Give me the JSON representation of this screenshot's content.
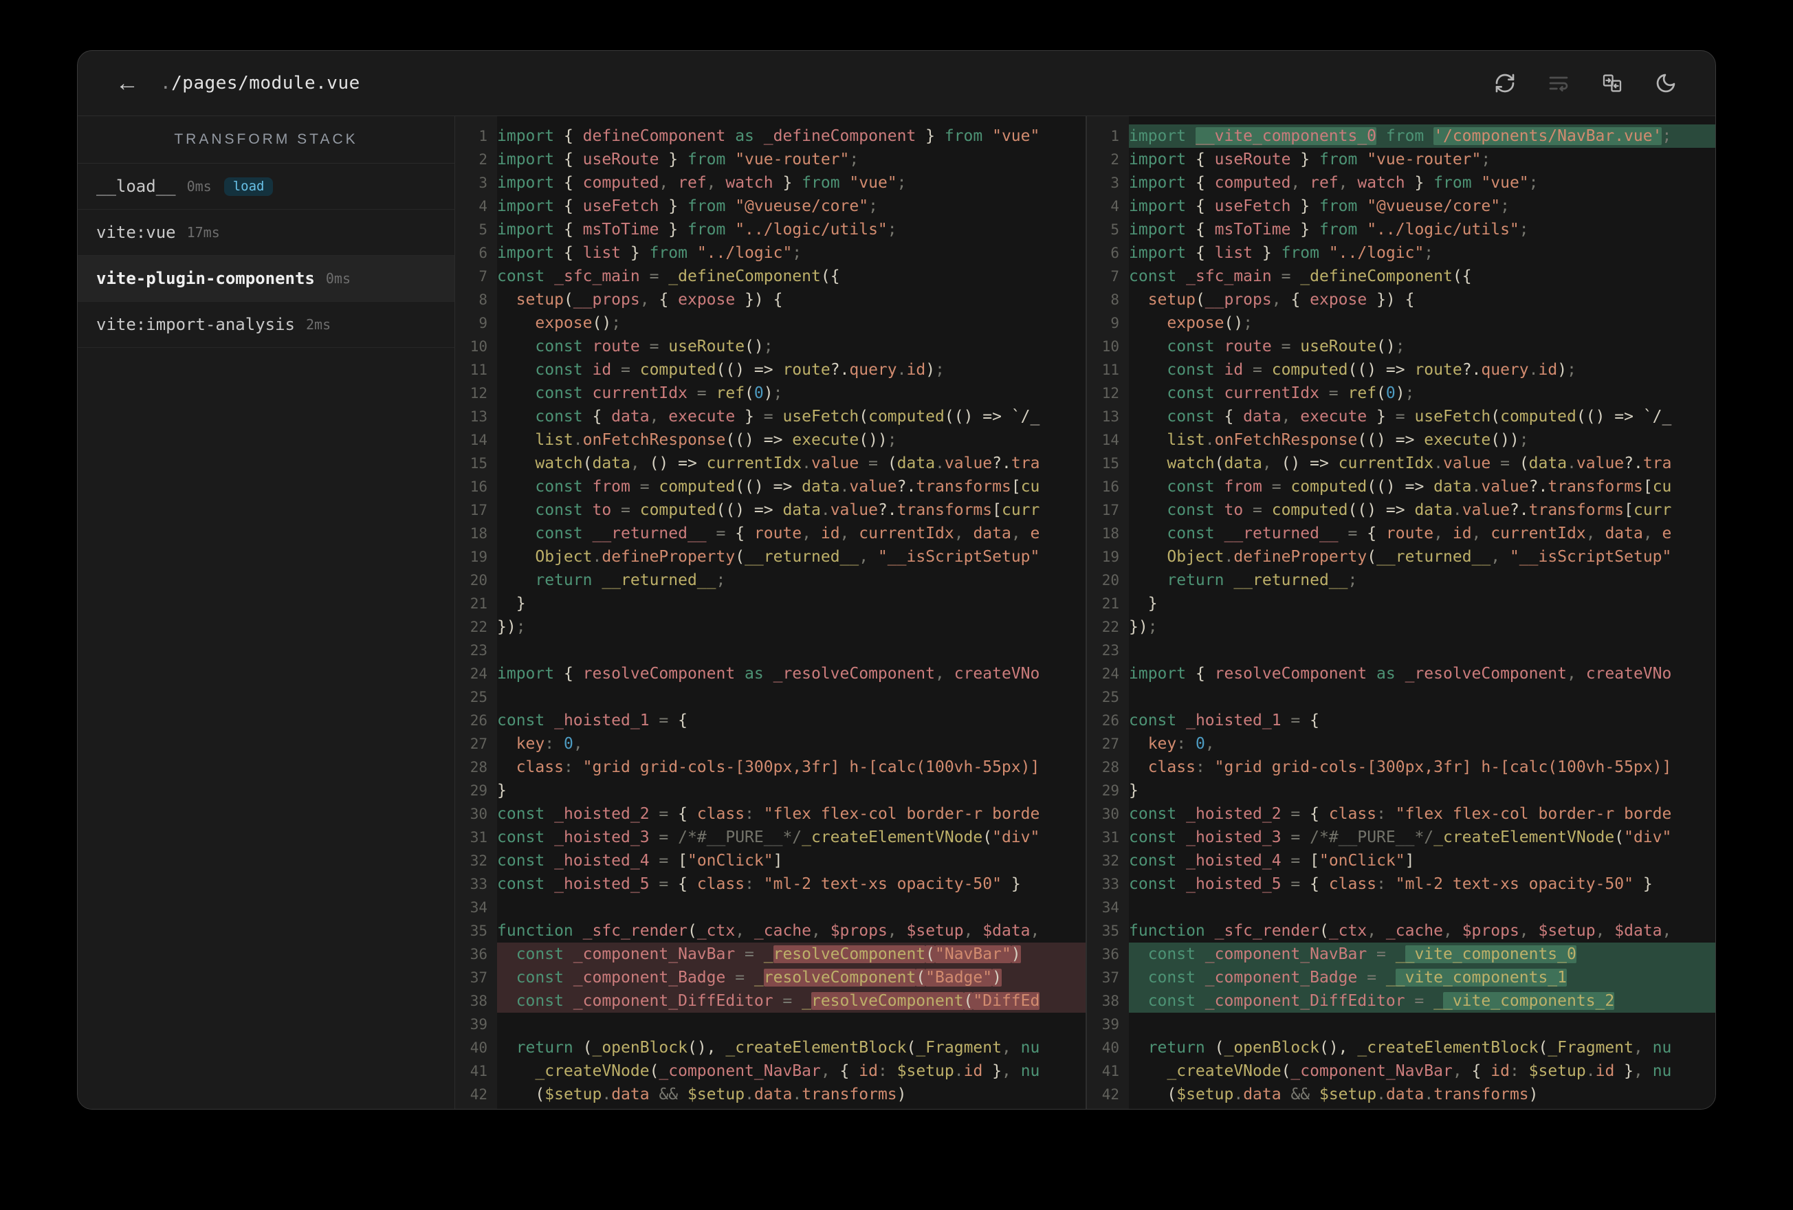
{
  "window": {
    "title_prefix": ".",
    "title": "/pages/module.vue",
    "back_label": "←"
  },
  "toolbar": {
    "icons": [
      "refresh-icon",
      "line-wrap-icon",
      "diff-compare-icon",
      "moon-icon"
    ]
  },
  "sidebar": {
    "header": "TRANSFORM STACK",
    "items": [
      {
        "name": "__load__",
        "time": "0ms",
        "badge": "load",
        "selected": false
      },
      {
        "name": "vite:vue",
        "time": "17ms",
        "badge": null,
        "selected": false
      },
      {
        "name": "vite-plugin-components",
        "time": "0ms",
        "badge": null,
        "selected": true
      },
      {
        "name": "vite:import-analysis",
        "time": "2ms",
        "badge": null,
        "selected": false
      }
    ]
  },
  "colors": {
    "keyword": "#4D9375",
    "declaration": "#CB7C7C",
    "reference": "#BDB069",
    "string": "#D28B6F",
    "punctuation": "#D6D1C2",
    "number": "#4D9BC1",
    "diff_del_line": "#3A2829",
    "diff_del_word": "#824A4A",
    "diff_add_line": "#2A4A3C",
    "diff_add_word": "#3F7158",
    "badge_text": "#68C0E6",
    "badge_bg": "#14323E"
  },
  "code": {
    "left_diff_del": [
      36,
      37,
      38
    ],
    "right_diff_add": [
      1,
      36,
      37,
      38
    ],
    "common_lines": [
      [
        [
          "k",
          "import"
        ],
        [
          "p",
          " { "
        ],
        [
          "d",
          "defineComponent"
        ],
        [
          "k",
          " as "
        ],
        [
          "d",
          "_defineComponent"
        ],
        [
          "p",
          " } "
        ],
        [
          "k",
          "from"
        ],
        [
          "s",
          " \"vue\""
        ]
      ],
      [
        [
          "k",
          "import"
        ],
        [
          "p",
          " { "
        ],
        [
          "d",
          "useRoute"
        ],
        [
          "p",
          " } "
        ],
        [
          "k",
          "from"
        ],
        [
          "s",
          " \"vue-router\""
        ],
        [
          "o",
          ";"
        ]
      ],
      [
        [
          "k",
          "import"
        ],
        [
          "p",
          " { "
        ],
        [
          "d",
          "computed"
        ],
        [
          "o",
          ", "
        ],
        [
          "d",
          "ref"
        ],
        [
          "o",
          ", "
        ],
        [
          "d",
          "watch"
        ],
        [
          "p",
          " } "
        ],
        [
          "k",
          "from"
        ],
        [
          "s",
          " \"vue\""
        ],
        [
          "o",
          ";"
        ]
      ],
      [
        [
          "k",
          "import"
        ],
        [
          "p",
          " { "
        ],
        [
          "d",
          "useFetch"
        ],
        [
          "p",
          " } "
        ],
        [
          "k",
          "from"
        ],
        [
          "s",
          " \"@vueuse/core\""
        ],
        [
          "o",
          ";"
        ]
      ],
      [
        [
          "k",
          "import"
        ],
        [
          "p",
          " { "
        ],
        [
          "d",
          "msToTime"
        ],
        [
          "p",
          " } "
        ],
        [
          "k",
          "from"
        ],
        [
          "s",
          " \"../logic/utils\""
        ],
        [
          "o",
          ";"
        ]
      ],
      [
        [
          "k",
          "import"
        ],
        [
          "p",
          " { "
        ],
        [
          "d",
          "list"
        ],
        [
          "p",
          " } "
        ],
        [
          "k",
          "from"
        ],
        [
          "s",
          " \"../logic\""
        ],
        [
          "o",
          ";"
        ]
      ],
      [
        [
          "k",
          "const"
        ],
        [
          "d",
          " _sfc_main"
        ],
        [
          "o",
          " = "
        ],
        [
          "u",
          "_defineComponent"
        ],
        [
          "p",
          "({"
        ]
      ],
      [
        [
          "s",
          "  setup"
        ],
        [
          "p",
          "("
        ],
        [
          "d",
          "__props"
        ],
        [
          "o",
          ", "
        ],
        [
          "p",
          "{ "
        ],
        [
          "d",
          "expose"
        ],
        [
          "p",
          " })"
        ],
        [
          "p",
          " {"
        ]
      ],
      [
        [
          "s",
          "    expose"
        ],
        [
          "p",
          "()"
        ],
        [
          "o",
          ";"
        ]
      ],
      [
        [
          "k",
          "    const"
        ],
        [
          "d",
          " route"
        ],
        [
          "o",
          " = "
        ],
        [
          "u",
          "useRoute"
        ],
        [
          "p",
          "()"
        ],
        [
          "o",
          ";"
        ]
      ],
      [
        [
          "k",
          "    const"
        ],
        [
          "d",
          " id"
        ],
        [
          "o",
          " = "
        ],
        [
          "u",
          "computed"
        ],
        [
          "p",
          "(() => "
        ],
        [
          "u",
          "route"
        ],
        [
          "p",
          "?."
        ],
        [
          "s",
          "query"
        ],
        [
          "o",
          "."
        ],
        [
          "s",
          "id"
        ],
        [
          "p",
          ")"
        ],
        [
          "o",
          ";"
        ]
      ],
      [
        [
          "k",
          "    const"
        ],
        [
          "d",
          " currentIdx"
        ],
        [
          "o",
          " = "
        ],
        [
          "u",
          "ref"
        ],
        [
          "p",
          "("
        ],
        [
          "n",
          "0"
        ],
        [
          "p",
          ")"
        ],
        [
          "o",
          ";"
        ]
      ],
      [
        [
          "k",
          "    const"
        ],
        [
          "p",
          " { "
        ],
        [
          "d",
          "data"
        ],
        [
          "o",
          ", "
        ],
        [
          "d",
          "execute"
        ],
        [
          "p",
          " } "
        ],
        [
          "o",
          "= "
        ],
        [
          "u",
          "useFetch"
        ],
        [
          "p",
          "("
        ],
        [
          "u",
          "computed"
        ],
        [
          "p",
          "(() => "
        ],
        [
          "w",
          "`/_"
        ]
      ],
      [
        [
          "u",
          "    list"
        ],
        [
          "o",
          "."
        ],
        [
          "s",
          "onFetchResponse"
        ],
        [
          "p",
          "(() => "
        ],
        [
          "u",
          "execute"
        ],
        [
          "p",
          "())"
        ],
        [
          "o",
          ";"
        ]
      ],
      [
        [
          "u",
          "    watch"
        ],
        [
          "p",
          "("
        ],
        [
          "u",
          "data"
        ],
        [
          "o",
          ", "
        ],
        [
          "p",
          "() => "
        ],
        [
          "u",
          "currentIdx"
        ],
        [
          "o",
          "."
        ],
        [
          "s",
          "value"
        ],
        [
          "o",
          " = "
        ],
        [
          "p",
          "("
        ],
        [
          "u",
          "data"
        ],
        [
          "o",
          "."
        ],
        [
          "s",
          "value"
        ],
        [
          "p",
          "?."
        ],
        [
          "s",
          "tra"
        ]
      ],
      [
        [
          "k",
          "    const"
        ],
        [
          "d",
          " from"
        ],
        [
          "o",
          " = "
        ],
        [
          "u",
          "computed"
        ],
        [
          "p",
          "(() => "
        ],
        [
          "u",
          "data"
        ],
        [
          "o",
          "."
        ],
        [
          "s",
          "value"
        ],
        [
          "p",
          "?."
        ],
        [
          "s",
          "transforms"
        ],
        [
          "p",
          "["
        ],
        [
          "u",
          "cu"
        ]
      ],
      [
        [
          "k",
          "    const"
        ],
        [
          "d",
          " to"
        ],
        [
          "o",
          " = "
        ],
        [
          "u",
          "computed"
        ],
        [
          "p",
          "(() => "
        ],
        [
          "u",
          "data"
        ],
        [
          "o",
          "."
        ],
        [
          "s",
          "value"
        ],
        [
          "p",
          "?."
        ],
        [
          "s",
          "transforms"
        ],
        [
          "p",
          "["
        ],
        [
          "u",
          "curr"
        ]
      ],
      [
        [
          "k",
          "    const"
        ],
        [
          "d",
          " __returned__"
        ],
        [
          "o",
          " = "
        ],
        [
          "p",
          "{ "
        ],
        [
          "s",
          "route"
        ],
        [
          "o",
          ", "
        ],
        [
          "s",
          "id"
        ],
        [
          "o",
          ", "
        ],
        [
          "s",
          "currentIdx"
        ],
        [
          "o",
          ", "
        ],
        [
          "s",
          "data"
        ],
        [
          "o",
          ", "
        ],
        [
          "s",
          "e"
        ]
      ],
      [
        [
          "u",
          "    Object"
        ],
        [
          "o",
          "."
        ],
        [
          "s",
          "defineProperty"
        ],
        [
          "p",
          "("
        ],
        [
          "u",
          "__returned__"
        ],
        [
          "o",
          ", "
        ],
        [
          "s",
          "\"__isScriptSetup\""
        ]
      ],
      [
        [
          "k",
          "    return"
        ],
        [
          "u",
          " __returned__"
        ],
        [
          "o",
          ";"
        ]
      ],
      [
        [
          "p",
          "  }"
        ]
      ],
      [
        [
          "p",
          "})"
        ],
        [
          "o",
          ";"
        ]
      ],
      [],
      [
        [
          "k",
          "import"
        ],
        [
          "p",
          " { "
        ],
        [
          "d",
          "resolveComponent"
        ],
        [
          "k",
          " as "
        ],
        [
          "d",
          "_resolveComponent"
        ],
        [
          "o",
          ", "
        ],
        [
          "d",
          "createVNo"
        ]
      ],
      [],
      [
        [
          "k",
          "const"
        ],
        [
          "d",
          " _hoisted_1"
        ],
        [
          "o",
          " = "
        ],
        [
          "p",
          "{"
        ]
      ],
      [
        [
          "s",
          "  key"
        ],
        [
          "o",
          ": "
        ],
        [
          "n",
          "0"
        ],
        [
          "o",
          ","
        ]
      ],
      [
        [
          "s",
          "  class"
        ],
        [
          "o",
          ": "
        ],
        [
          "s",
          "\"grid grid-cols-[300px,3fr] h-[calc(100vh-55px)]"
        ]
      ],
      [
        [
          "p",
          "}"
        ]
      ],
      [
        [
          "k",
          "const"
        ],
        [
          "d",
          " _hoisted_2"
        ],
        [
          "o",
          " = "
        ],
        [
          "p",
          "{ "
        ],
        [
          "s",
          "class"
        ],
        [
          "o",
          ": "
        ],
        [
          "s",
          "\"flex flex-col border-r borde"
        ]
      ],
      [
        [
          "k",
          "const"
        ],
        [
          "d",
          " _hoisted_3"
        ],
        [
          "o",
          " = "
        ],
        [
          "c",
          "/*#__PURE__*/"
        ],
        [
          "u",
          "_createElementVNode"
        ],
        [
          "p",
          "("
        ],
        [
          "s",
          "\"div\""
        ]
      ],
      [
        [
          "k",
          "const"
        ],
        [
          "d",
          " _hoisted_4"
        ],
        [
          "o",
          " = "
        ],
        [
          "p",
          "["
        ],
        [
          "s",
          "\"onClick\""
        ],
        [
          "p",
          "]"
        ]
      ],
      [
        [
          "k",
          "const"
        ],
        [
          "d",
          " _hoisted_5"
        ],
        [
          "o",
          " = "
        ],
        [
          "p",
          "{ "
        ],
        [
          "s",
          "class"
        ],
        [
          "o",
          ": "
        ],
        [
          "s",
          "\"ml-2 text-xs opacity-50\""
        ],
        [
          "p",
          " }"
        ]
      ],
      [],
      [
        [
          "k",
          "function"
        ],
        [
          "d",
          " _sfc_render"
        ],
        [
          "p",
          "("
        ],
        [
          "d",
          "_ctx"
        ],
        [
          "o",
          ", "
        ],
        [
          "d",
          "_cache"
        ],
        [
          "o",
          ", "
        ],
        [
          "d",
          "$props"
        ],
        [
          "o",
          ", "
        ],
        [
          "d",
          "$setup"
        ],
        [
          "o",
          ", "
        ],
        [
          "d",
          "$data"
        ],
        [
          "o",
          ","
        ]
      ],
      [
        [
          "k",
          "  const"
        ],
        [
          "d",
          " _component_NavBar"
        ],
        [
          "o",
          " = "
        ],
        [
          "u",
          "_"
        ],
        [
          "u",
          "resolveComponent",
          1
        ],
        [
          "p",
          "(",
          1
        ],
        [
          "s",
          "\"NavBar\"",
          1
        ],
        [
          "p",
          ")",
          1
        ]
      ],
      [
        [
          "k",
          "  const"
        ],
        [
          "d",
          " _component_Badge"
        ],
        [
          "o",
          " = "
        ],
        [
          "u",
          "_"
        ],
        [
          "u",
          "resolveComponent",
          1
        ],
        [
          "p",
          "(",
          1
        ],
        [
          "s",
          "\"Badge\"",
          1
        ],
        [
          "p",
          ")",
          1
        ]
      ],
      [
        [
          "k",
          "  const"
        ],
        [
          "d",
          " _component_DiffEditor"
        ],
        [
          "o",
          " = "
        ],
        [
          "u",
          "_"
        ],
        [
          "u",
          "resolveComponent",
          1
        ],
        [
          "p",
          "(",
          1
        ],
        [
          "s",
          "\"DiffEd",
          1
        ]
      ],
      [],
      [
        [
          "k",
          "  return"
        ],
        [
          "p",
          " ("
        ],
        [
          "u",
          "_openBlock"
        ],
        [
          "p",
          "(), "
        ],
        [
          "u",
          "_createElementBlock"
        ],
        [
          "p",
          "("
        ],
        [
          "u",
          "_Fragment"
        ],
        [
          "o",
          ", "
        ],
        [
          "k",
          "nu"
        ]
      ],
      [
        [
          "u",
          "    _createVNode"
        ],
        [
          "p",
          "("
        ],
        [
          "d",
          "_component_NavBar"
        ],
        [
          "o",
          ", "
        ],
        [
          "p",
          "{ "
        ],
        [
          "s",
          "id"
        ],
        [
          "o",
          ": "
        ],
        [
          "u",
          "$setup"
        ],
        [
          "o",
          "."
        ],
        [
          "s",
          "id"
        ],
        [
          "p",
          " }"
        ],
        [
          "o",
          ", "
        ],
        [
          "k",
          "nu"
        ]
      ],
      [
        [
          "p",
          "    ("
        ],
        [
          "u",
          "$setup"
        ],
        [
          "o",
          "."
        ],
        [
          "s",
          "data"
        ],
        [
          "o",
          " && "
        ],
        [
          "u",
          "$setup"
        ],
        [
          "o",
          "."
        ],
        [
          "s",
          "data"
        ],
        [
          "o",
          "."
        ],
        [
          "s",
          "transforms"
        ],
        [
          "p",
          ")"
        ]
      ]
    ],
    "right_overrides": {
      "1": [
        [
          "k",
          "import "
        ],
        [
          "d",
          "__vite_components_0",
          1
        ],
        [
          "k",
          " from "
        ],
        [
          "s",
          "'/components/NavBar.vue'",
          1
        ],
        [
          "o",
          ";"
        ]
      ],
      "36": [
        [
          "k",
          "  const"
        ],
        [
          "d",
          " _component_NavBar"
        ],
        [
          "o",
          " = "
        ],
        [
          "u",
          "_"
        ],
        [
          "u",
          "_vite_components_0",
          1
        ]
      ],
      "37": [
        [
          "k",
          "  const"
        ],
        [
          "d",
          " _component_Badge"
        ],
        [
          "o",
          " = "
        ],
        [
          "u",
          "_"
        ],
        [
          "u",
          "_vite_components_1",
          1
        ]
      ],
      "38": [
        [
          "k",
          "  const"
        ],
        [
          "d",
          " _component_DiffEditor"
        ],
        [
          "o",
          " = "
        ],
        [
          "u",
          "_"
        ],
        [
          "u",
          "_vite_components_2",
          1
        ]
      ]
    }
  }
}
